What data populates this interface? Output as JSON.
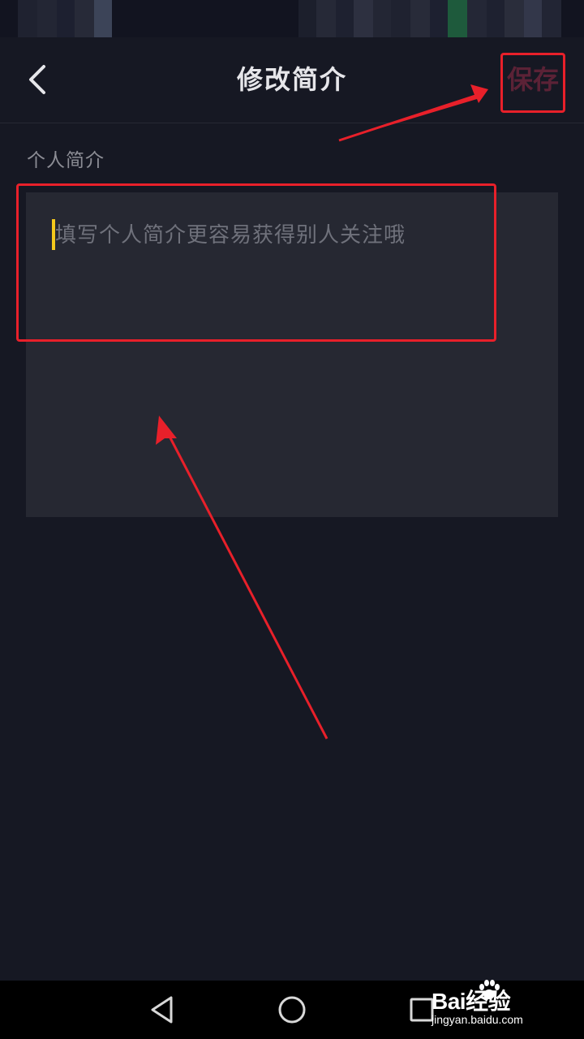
{
  "header": {
    "title": "修改简介",
    "save_label": "保存"
  },
  "bio_section": {
    "label": "个人简介",
    "placeholder": "填写个人简介更容易获得别人关注哦",
    "value": ""
  },
  "watermark": {
    "brand": "Bai经验",
    "domain": "jingyan.baidu.com"
  },
  "colors": {
    "background": "#161823",
    "input_background": "#262832",
    "caret": "#f3c81c",
    "save_disabled": "#5b2236",
    "annotation": "#e8202a"
  },
  "icons": {
    "back": "chevron-left-icon",
    "nav_back": "triangle-back-icon",
    "nav_home": "circle-home-icon",
    "nav_recent": "square-recents-icon"
  }
}
